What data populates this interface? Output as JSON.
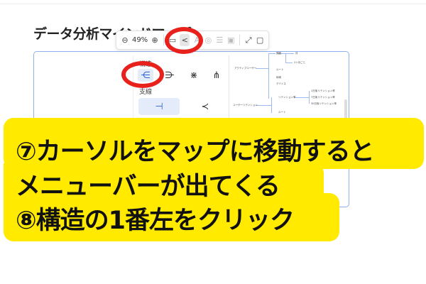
{
  "page": {
    "title": "データ分析マインドマップ"
  },
  "toolbar": {
    "zoom_level": "49%",
    "icons": [
      "zoom-out-icon",
      "zoom-in-icon",
      "fit-icon",
      "structure-icon",
      "text-style-icon",
      "check-icon",
      "list-icon",
      "image-icon",
      "expand-icon",
      "comment-icon"
    ]
  },
  "panel": {
    "structure_label": "構造",
    "branch_label": "支線"
  },
  "map": {
    "nodes": {
      "active_users": "アクティブユーザー",
      "frequency": "頻度",
      "month": "月",
      "two_months": "2ヶ月ごと",
      "route1": "ルート",
      "region": "地域",
      "device": "デバイス",
      "retention": "ユーザーリテンション",
      "retention_rate": "リテンション率",
      "d1": "1日後リテンション率",
      "d7": "7日後リテンション率",
      "d30": "30日後リテンション率",
      "route2": "ルート"
    }
  },
  "annotation": {
    "line1": "⑦カーソルをマップに移動すると",
    "line2": "メニューバーが出てくる",
    "line3": "⑧構造の1番左をクリック"
  },
  "colors": {
    "highlight": "#ffea00",
    "circle": "#e8211c",
    "accent": "#2b62d9"
  }
}
